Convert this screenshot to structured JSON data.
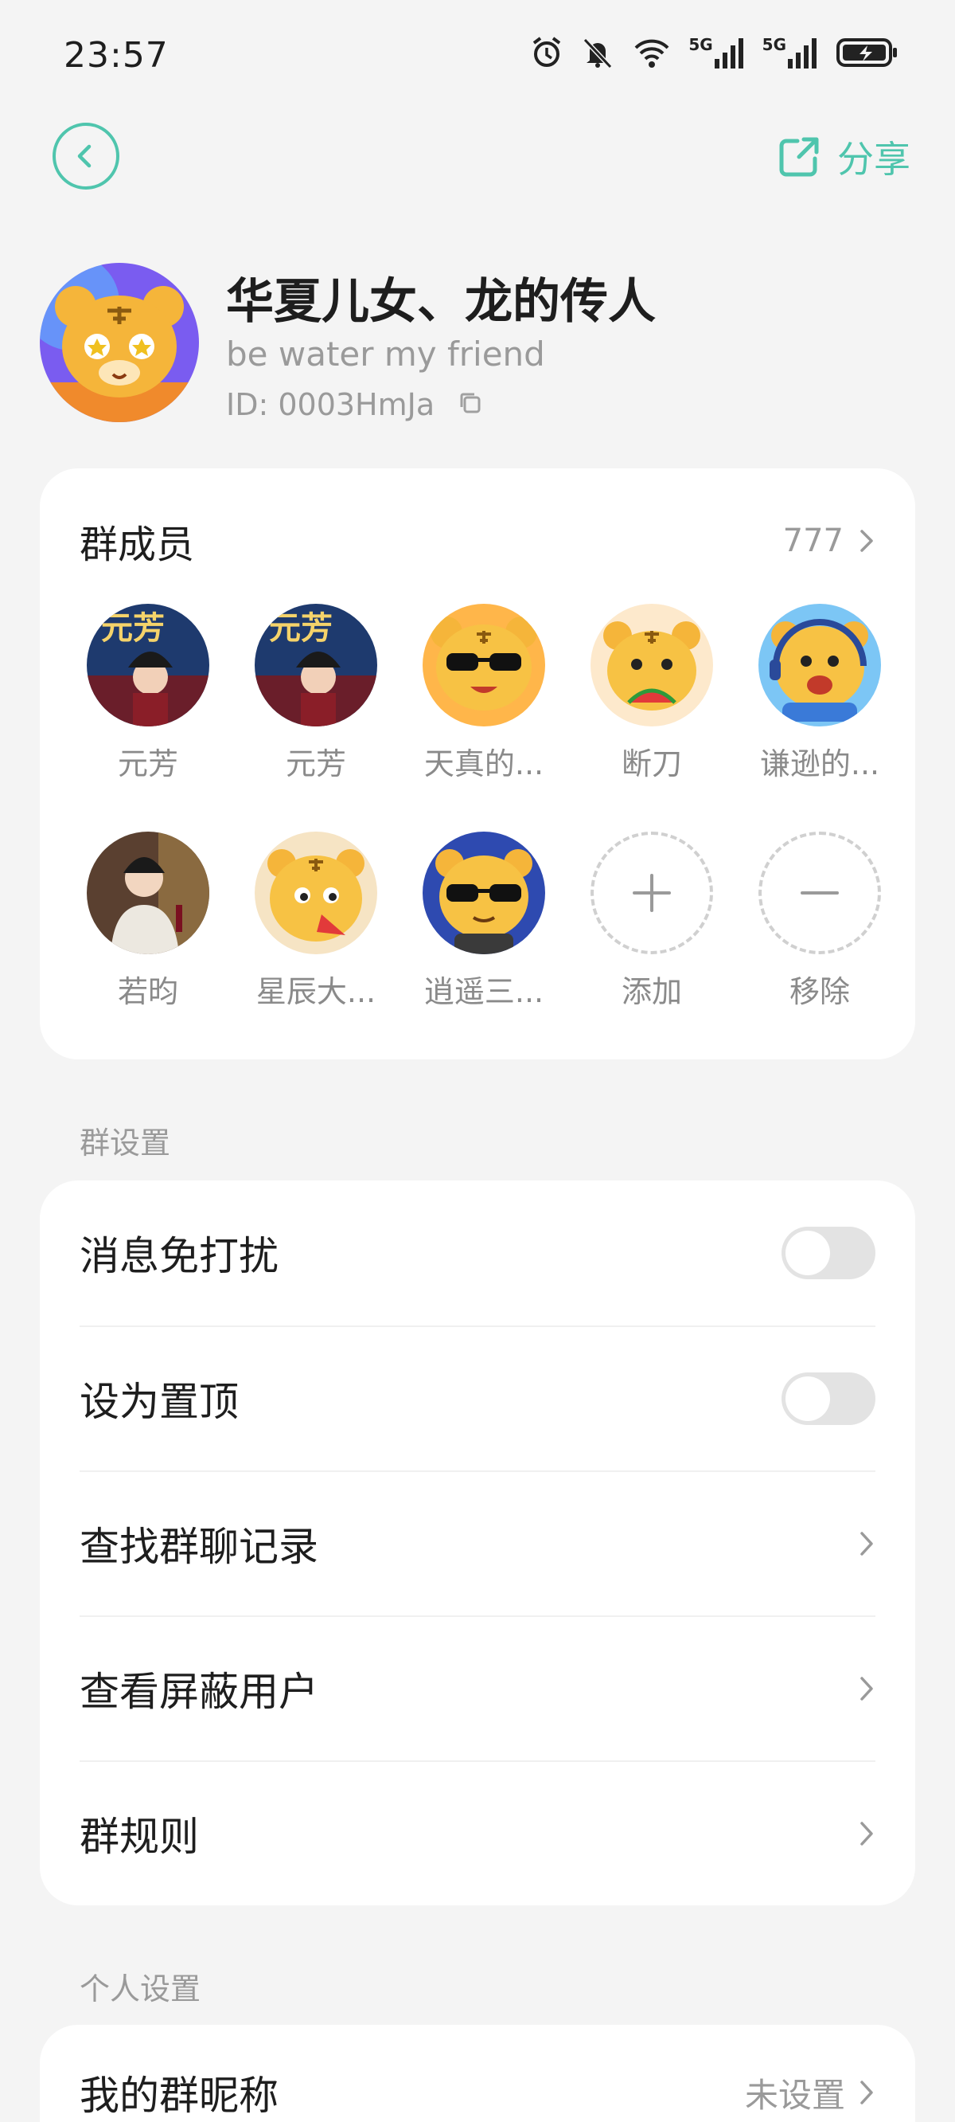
{
  "status_bar": {
    "time": "23:57",
    "net1": "5G",
    "net2": "5G"
  },
  "top_bar": {
    "share_label": "分享"
  },
  "group": {
    "name": "华夏儿女、龙的传人",
    "motto": "be water my friend",
    "id": "ID: 0003HmJa"
  },
  "members": {
    "title": "群成员",
    "count": "777",
    "items": [
      {
        "name": "元芳",
        "avatar": "poster"
      },
      {
        "name": "元芳",
        "avatar": "poster"
      },
      {
        "name": "天真的...",
        "avatar": "tiger-sunglasses"
      },
      {
        "name": "断刀",
        "avatar": "tiger-watermelon"
      },
      {
        "name": "谦逊的...",
        "avatar": "tiger-headset"
      },
      {
        "name": "若昀",
        "avatar": "photo"
      },
      {
        "name": "星辰大...",
        "avatar": "tiger-melon"
      },
      {
        "name": "逍遥三...",
        "avatar": "tiger-cool"
      }
    ],
    "add_label": "添加",
    "remove_label": "移除"
  },
  "group_settings": {
    "section_title": "群设置",
    "mute_label": "消息免打扰",
    "mute_on": false,
    "pin_label": "设为置顶",
    "pin_on": false,
    "search_history_label": "查找群聊记录",
    "blocked_users_label": "查看屏蔽用户",
    "rules_label": "群规则"
  },
  "personal_settings": {
    "section_title": "个人设置",
    "nickname_label": "我的群昵称",
    "nickname_value": "未设置"
  },
  "colors": {
    "accent": "#4fc5ad",
    "tiger": "#f5b53a",
    "background": "#f4f4f4"
  }
}
